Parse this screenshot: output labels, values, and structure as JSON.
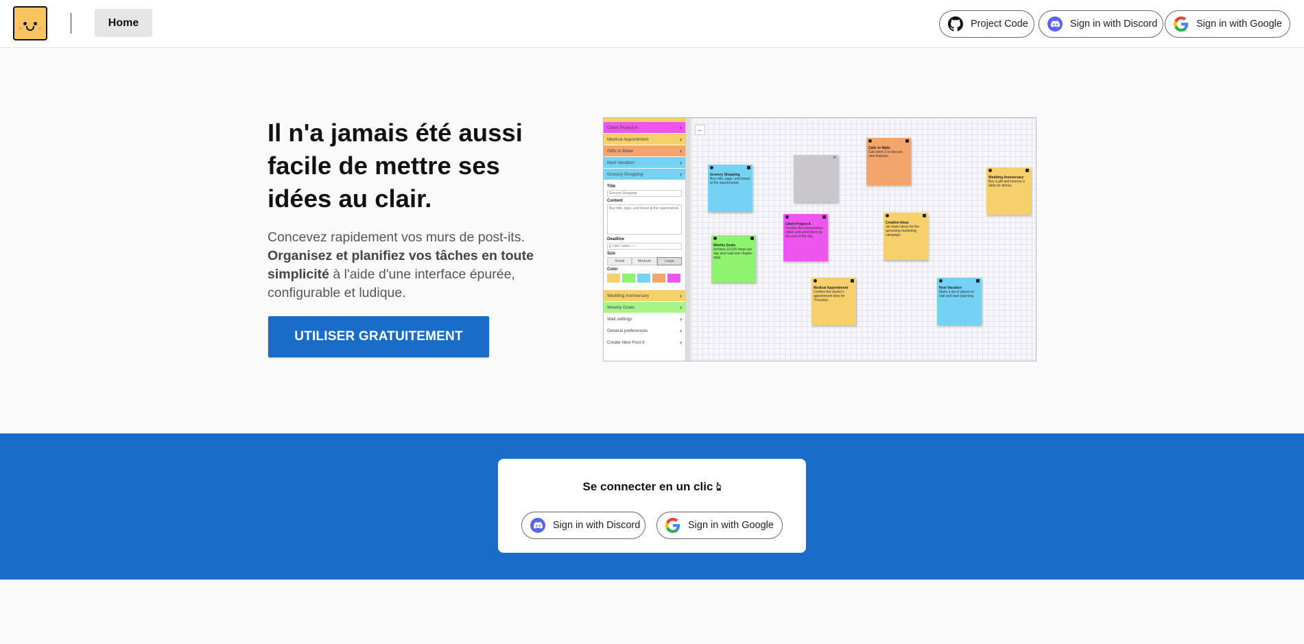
{
  "header": {
    "home_label": "Home",
    "project_code_label": "Project Code",
    "discord_label": "Sign in with Discord",
    "google_label": "Sign in with Google"
  },
  "hero": {
    "headline": "Il n'a jamais été aussi facile de mettre ses idées au clair.",
    "desc_part1": "Concevez rapidement vos murs de post-its.",
    "desc_bold": "Organisez et planifiez vos tâches en toute simplicité",
    "desc_part2": "à l'aide d'une interface épurée, configurable et ludique.",
    "cta_label": "UTILISER GRATUITEMENT"
  },
  "preview": {
    "sidebar_items_top": [
      {
        "label": "Client Project A",
        "color": "#ee55ee"
      },
      {
        "label": "Medical Appointment",
        "color": "#f7cf6b"
      },
      {
        "label": "Gifts to Make",
        "color": "#f3a56b"
      },
      {
        "label": "Next Vacation",
        "color": "#74d2f5"
      },
      {
        "label": "Grocery Shopping",
        "color": "#74d2f5"
      }
    ],
    "form": {
      "title_label": "Title",
      "title_value": "Grocery Shopping",
      "content_label": "Content",
      "content_value": "Buy milk, eggs, and bread at the supermarket.",
      "deadline_label": "Deadline",
      "deadline_value": "jj / mm / aaaa  --:--",
      "size_label": "Size",
      "sizes": [
        "Small",
        "Medium",
        "Large"
      ],
      "color_label": "Color",
      "swatches": [
        "#f7cf6b",
        "#8ef46e",
        "#74d2f5",
        "#f3a56b",
        "#ee55ee"
      ]
    },
    "sidebar_items_bottom": [
      {
        "label": "Wedding Anniversary",
        "color": "#f7cf6b"
      },
      {
        "label": "Weekly Goals",
        "color": "#a6f48a"
      },
      {
        "label": "Wall settings",
        "color": "#ffffff"
      },
      {
        "label": "General preferences",
        "color": "#ffffff"
      },
      {
        "label": "Create New Post-it",
        "color": "#ffffff"
      }
    ],
    "notes": [
      {
        "title": "Grocery Shopping",
        "text": "Buy milk, eggs, and bread at the supermarket.",
        "color": "#74d2f5"
      },
      {
        "title": "Calls to Make",
        "text": "Call client 3 to discuss new features.",
        "color": "#f3a56b"
      },
      {
        "title": "Wedding Anniversary",
        "text": "Buy a gift and reserve a table for dinner.",
        "color": "#f7cf6b"
      },
      {
        "title": "Client Project A",
        "text": "Finalize the presentation slides and send them by the end of the day.",
        "color": "#ee55ee"
      },
      {
        "title": "Creative Ideas",
        "text": "Jot down ideas for the upcoming marketing campaign.",
        "color": "#f7cf6b"
      },
      {
        "title": "Weekly Goals",
        "text": "Achieve 10,000 steps per day and read one chapter daily.",
        "color": "#8ef46e"
      },
      {
        "title": "Medical Appointment",
        "text": "Confirm the doctor's appointment time for Thursday.",
        "color": "#f7cf6b"
      },
      {
        "title": "Next Vacation",
        "text": "Make a list of places to visit and start planning.",
        "color": "#74d2f5"
      }
    ]
  },
  "connect": {
    "title": "Se connecter en un clic",
    "discord_label": "Sign in with Discord",
    "google_label": "Sign in with Google"
  },
  "colors": {
    "brand_blue": "#1a6cc9",
    "logo_yellow": "#f7c55e",
    "discord": "#5865f2"
  }
}
